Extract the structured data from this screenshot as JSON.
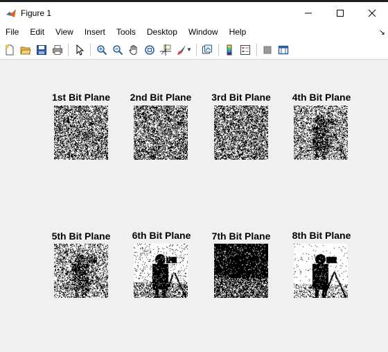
{
  "window": {
    "title": "Figure 1",
    "controls": {
      "minimize": "—",
      "maximize": "☐",
      "close": "✕"
    }
  },
  "menu": {
    "items": [
      "File",
      "Edit",
      "View",
      "Insert",
      "Tools",
      "Desktop",
      "Window",
      "Help"
    ],
    "dock_glyph": "↘"
  },
  "toolbar": {
    "icons": [
      "new-figure-icon",
      "open-file-icon",
      "save-icon",
      "print-icon",
      "pointer-icon",
      "zoom-in-icon",
      "zoom-out-icon",
      "pan-icon",
      "rotate-3d-icon",
      "data-cursor-icon",
      "brush-icon",
      "link-plot-icon",
      "colorbar-icon",
      "legend-icon",
      "hide-plot-tools-icon",
      "show-plot-tools-icon"
    ]
  },
  "subplots": [
    {
      "title": "1st Bit Plane",
      "density": 0.5,
      "mode": "noise"
    },
    {
      "title": "2nd Bit Plane",
      "density": 0.5,
      "mode": "noise"
    },
    {
      "title": "3rd Bit Plane",
      "density": 0.5,
      "mode": "noise"
    },
    {
      "title": "4th Bit Plane",
      "density": 0.55,
      "mode": "grainy"
    },
    {
      "title": "5th Bit Plane",
      "density": 0.5,
      "mode": "grainy"
    },
    {
      "title": "6th Bit Plane",
      "density": 0.5,
      "mode": "scene"
    },
    {
      "title": "7th Bit Plane",
      "density": 0.5,
      "mode": "dark"
    },
    {
      "title": "8th Bit Plane",
      "density": 0.5,
      "mode": "photo"
    }
  ]
}
